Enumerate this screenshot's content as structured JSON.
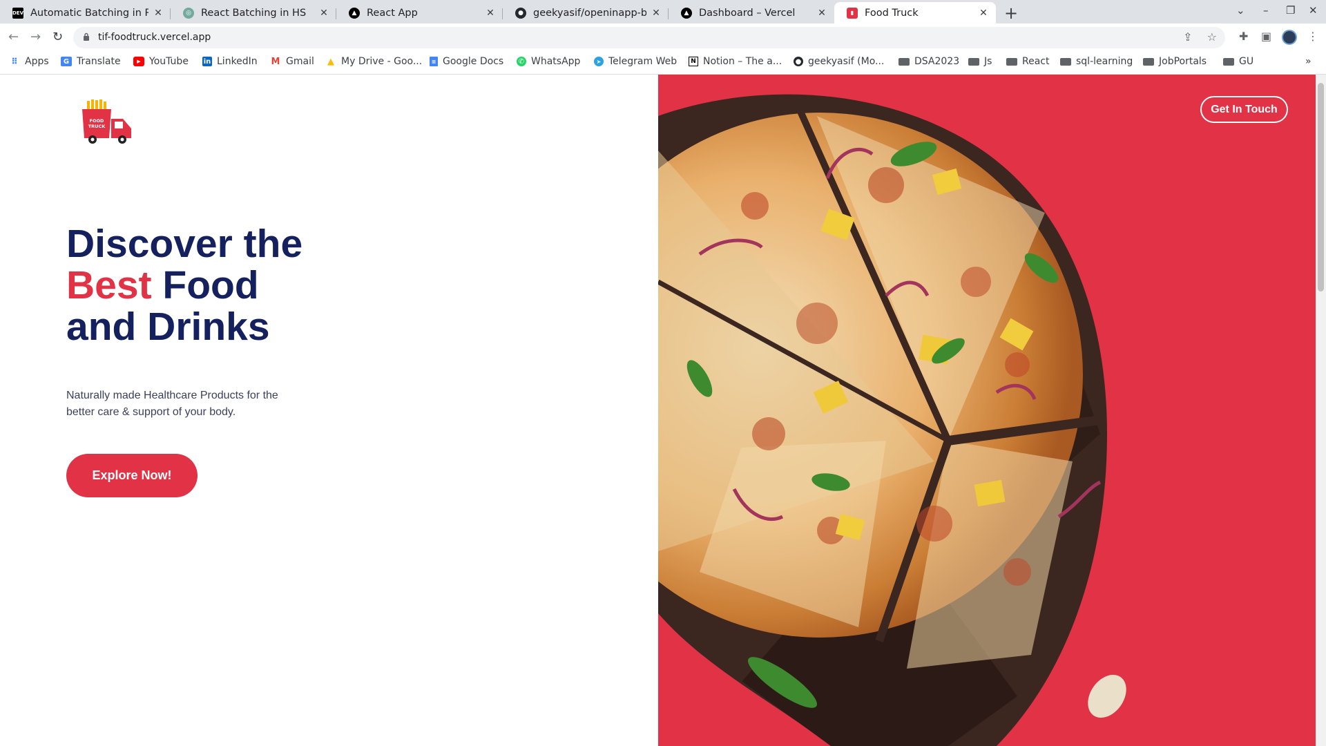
{
  "browser": {
    "tabs": [
      {
        "title": "Automatic Batching in Re",
        "favicon": "dev-icon"
      },
      {
        "title": "React Batching in HS",
        "favicon": "openai-icon"
      },
      {
        "title": "React App",
        "favicon": "vercel-icon"
      },
      {
        "title": "geekyasif/openinapp-bo",
        "favicon": "github-icon"
      },
      {
        "title": "Dashboard – Vercel",
        "favicon": "vercel-icon"
      },
      {
        "title": "Food Truck",
        "favicon": "food-truck-icon"
      }
    ],
    "url": "tif-foodtruck.vercel.app",
    "bookmarks": [
      {
        "label": "Apps",
        "icon": "apps-grid-icon"
      },
      {
        "label": "Translate",
        "icon": "translate-icon"
      },
      {
        "label": "YouTube",
        "icon": "youtube-icon"
      },
      {
        "label": "LinkedIn",
        "icon": "linkedin-icon"
      },
      {
        "label": "Gmail",
        "icon": "gmail-icon"
      },
      {
        "label": "My Drive - Goo...",
        "icon": "drive-icon"
      },
      {
        "label": "Google Docs",
        "icon": "docs-icon"
      },
      {
        "label": "WhatsApp",
        "icon": "whatsapp-icon"
      },
      {
        "label": "Telegram Web",
        "icon": "telegram-icon"
      },
      {
        "label": "Notion – The a...",
        "icon": "notion-icon"
      },
      {
        "label": "geekyasif (Mo...",
        "icon": "github-icon"
      },
      {
        "label": "DSA2023",
        "icon": "folder-icon"
      },
      {
        "label": "Js",
        "icon": "folder-icon"
      },
      {
        "label": "React",
        "icon": "folder-icon"
      },
      {
        "label": "sql-learning",
        "icon": "folder-icon"
      },
      {
        "label": "JobPortals",
        "icon": "folder-icon"
      },
      {
        "label": "GU",
        "icon": "folder-icon"
      }
    ],
    "bookmarks_overflow": "»"
  },
  "page": {
    "logo_text": {
      "line1": "FOOD",
      "line2": "TRUCK"
    },
    "hero": {
      "title_line1": "Discover the",
      "title_accent": "Best",
      "title_line2_rest": "Food",
      "title_line3": "and Drinks",
      "description": "Naturally made Healthcare Products for the better care & support of your body.",
      "cta_label": "Explore Now!"
    },
    "contact_label": "Get In Touch"
  },
  "colors": {
    "brand_red": "#e13246",
    "brand_navy": "#14215e",
    "body_text": "#3a3f5c"
  }
}
